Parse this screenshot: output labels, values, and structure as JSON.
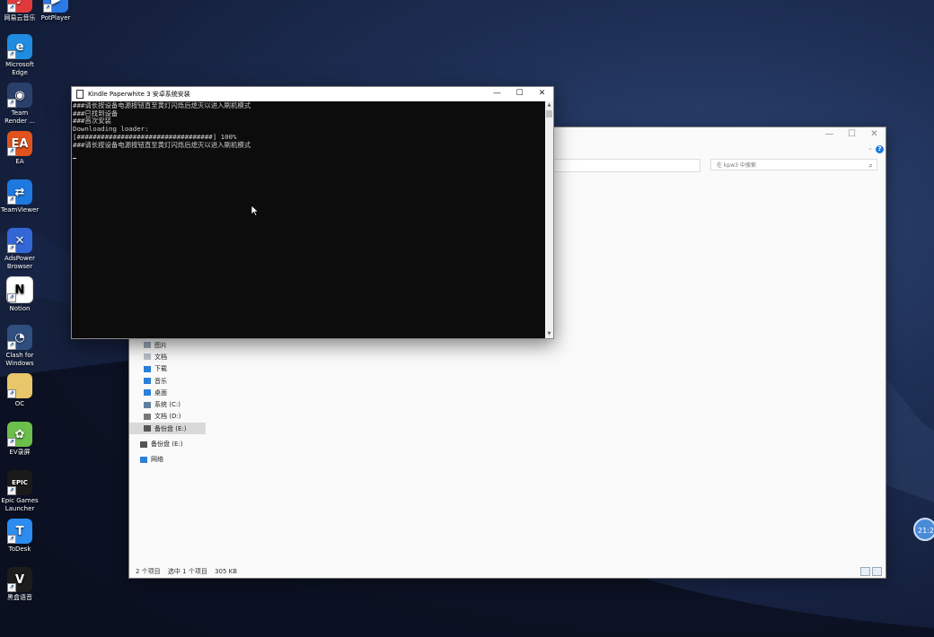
{
  "desktop": {
    "icons": [
      {
        "label": "网易云音乐",
        "color": "#e23a3a",
        "glyph": "♪"
      },
      {
        "label": "PotPlayer",
        "color": "#2c7ae6",
        "glyph": "▶"
      },
      {
        "label": "Microsoft Edge",
        "color": "#1f8ce0",
        "glyph": "e"
      },
      {
        "label": "Team Render ...",
        "color": "#2a3f6a",
        "glyph": "◉"
      },
      {
        "label": "EA",
        "color": "#e0531c",
        "glyph": "EA"
      },
      {
        "label": "TeamViewer",
        "color": "#1d79df",
        "glyph": "⇄"
      },
      {
        "label": "AdsPower Browser",
        "color": "#3367d6",
        "glyph": "✕"
      },
      {
        "label": "Notion",
        "color": "#ffffff",
        "glyph": "N"
      },
      {
        "label": "Clash for Windows",
        "color": "#2f4f7f",
        "glyph": "◔"
      },
      {
        "label": "OC",
        "color": "#e8c66a",
        "glyph": ""
      },
      {
        "label": "EV录屏",
        "color": "#6dbf4b",
        "glyph": "✿"
      },
      {
        "label": "Epic Games Launcher",
        "color": "#1a1a1a",
        "glyph": "EPIC"
      },
      {
        "label": "ToDesk",
        "color": "#2d8cf0",
        "glyph": "T"
      },
      {
        "label": "黑盒语音",
        "color": "#1c1c1c",
        "glyph": "V"
      }
    ]
  },
  "explorer": {
    "search_placeholder": "在 kpw3 中搜索",
    "nav": [
      {
        "label": "图片",
        "color": "#9aa8b8"
      },
      {
        "label": "文档",
        "color": "#b8bec8"
      },
      {
        "label": "下载",
        "color": "#2c7fd8"
      },
      {
        "label": "音乐",
        "color": "#2c7fd8"
      },
      {
        "label": "桌面",
        "color": "#2c7fd8"
      },
      {
        "label": "系统 (C:)",
        "color": "#5f7f9f"
      },
      {
        "label": "文档 (D:)",
        "color": "#777777"
      },
      {
        "label": "备份盘 (E:)",
        "color": "#555555"
      },
      {
        "label": "备份盘 (E:)",
        "color": "#555555"
      },
      {
        "label": "网络",
        "color": "#2c7fd8"
      }
    ],
    "status": {
      "items": "2 个项目",
      "selected": "选中 1 个项目",
      "size": "305 KB"
    }
  },
  "console": {
    "title": "Kindle Paperwhite 3 安卓系统安装",
    "lines": [
      "###请长按设备电源按钮直至黄灯闪烁后熄灭以进入刷机模式",
      "###已找到设备",
      "###首次安装",
      "Downloading loader:",
      "[##################################] 100%",
      "###请长按设备电源按钮直至黄灯闪烁后熄灭以进入刷机模式"
    ]
  },
  "clock": {
    "time": "21:21"
  }
}
